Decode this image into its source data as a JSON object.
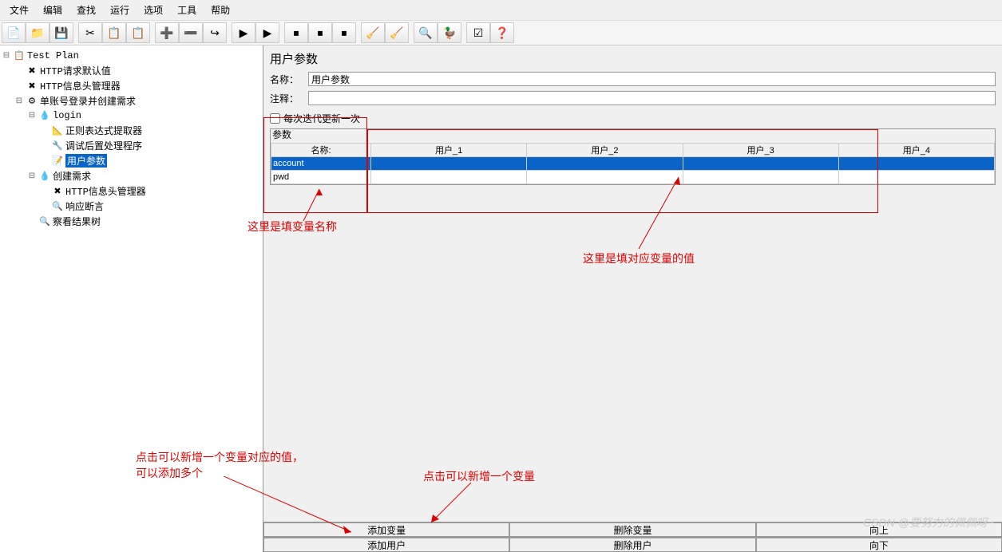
{
  "menu": {
    "items": [
      "文件",
      "编辑",
      "查找",
      "运行",
      "选项",
      "工具",
      "帮助"
    ]
  },
  "toolbar_icons": [
    "📄",
    "📁",
    "💾",
    "",
    "✂",
    "📋",
    "📋",
    "",
    "➕",
    "➖",
    "↪",
    "",
    "▶",
    "▶",
    "",
    "⏹",
    "⏹",
    "⏹",
    "",
    "🧹",
    "🧹",
    "",
    "🔍",
    "🦆",
    "",
    "☑",
    "❓"
  ],
  "tree": [
    {
      "indent": 0,
      "toggle": "⊟",
      "icon": "📋",
      "label": "Test Plan"
    },
    {
      "indent": 1,
      "toggle": "",
      "icon": "✖",
      "label": "HTTP请求默认值"
    },
    {
      "indent": 1,
      "toggle": "",
      "icon": "✖",
      "label": "HTTP信息头管理器"
    },
    {
      "indent": 1,
      "toggle": "⊟",
      "icon": "⚙",
      "label": "单账号登录并创建需求"
    },
    {
      "indent": 2,
      "toggle": "⊟",
      "icon": "💧",
      "label": "login"
    },
    {
      "indent": 3,
      "toggle": "",
      "icon": "📐",
      "label": "正则表达式提取器"
    },
    {
      "indent": 3,
      "toggle": "",
      "icon": "🔧",
      "label": "调试后置处理程序"
    },
    {
      "indent": 3,
      "toggle": "",
      "icon": "📝",
      "label": "用户参数",
      "selected": true
    },
    {
      "indent": 2,
      "toggle": "⊟",
      "icon": "💧",
      "label": "创建需求"
    },
    {
      "indent": 3,
      "toggle": "",
      "icon": "✖",
      "label": "HTTP信息头管理器"
    },
    {
      "indent": 3,
      "toggle": "",
      "icon": "🔍",
      "label": "响应断言"
    },
    {
      "indent": 2,
      "toggle": "",
      "icon": "🔍",
      "label": "察看结果树"
    }
  ],
  "panel": {
    "title": "用户参数",
    "name_label": "名称：",
    "name_value": "用户参数",
    "comment_label": "注释：",
    "comment_value": "",
    "iterate_label": "每次迭代更新一次",
    "params_legend": "参数",
    "headers": [
      "名称:",
      "用户_1",
      "用户_2",
      "用户_3",
      "用户_4"
    ],
    "rows": [
      {
        "name": "account",
        "selected": true,
        "vals": [
          "",
          "",
          "",
          ""
        ]
      },
      {
        "name": "pwd",
        "selected": false,
        "vals": [
          "",
          "",
          "",
          ""
        ]
      }
    ],
    "buttons": {
      "add_var": "添加变量",
      "del_var": "删除变量",
      "up": "向上",
      "add_user": "添加用户",
      "del_user": "删除用户",
      "down": "向下"
    }
  },
  "annotations": {
    "a1": "这里是填变量名称",
    "a2": "这里是填对应变量的值",
    "a3": "点击可以新增一个变量对应的值，",
    "a3b": "可以添加多个",
    "a4": "点击可以新增一个变量"
  },
  "watermark": "CSDN @要努力的佩佩呀~"
}
